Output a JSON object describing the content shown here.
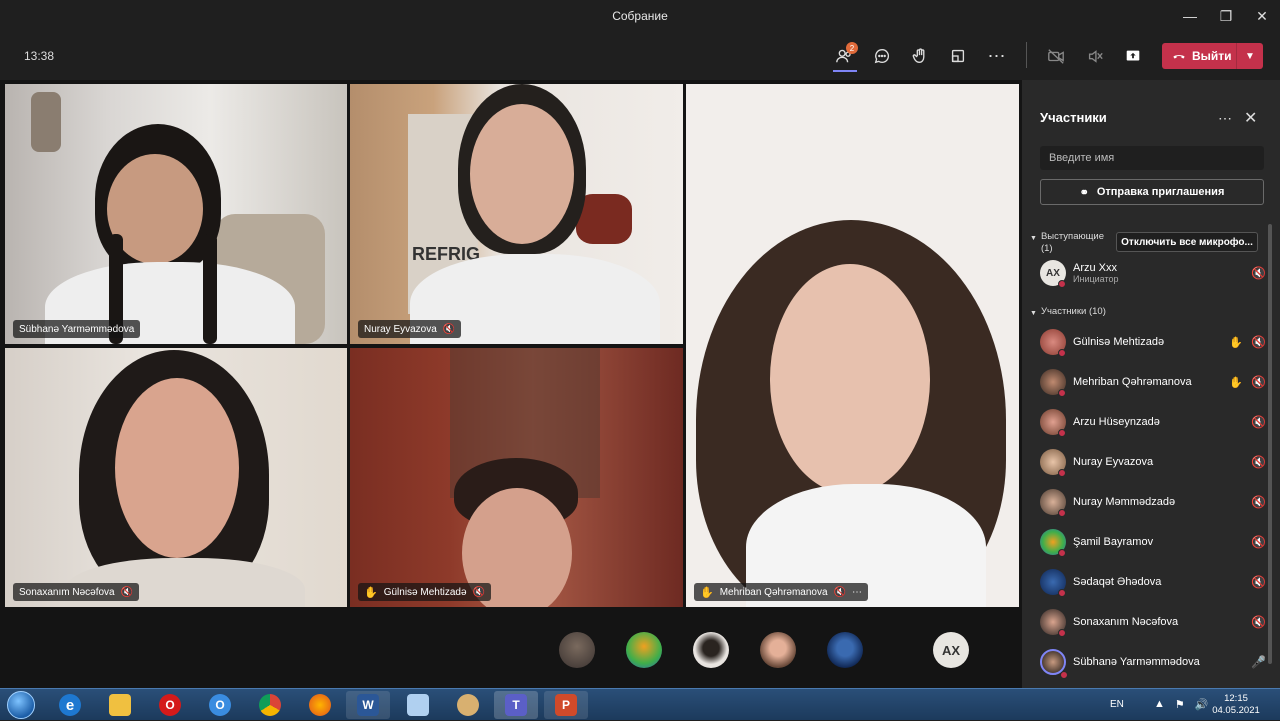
{
  "window": {
    "title": "Собрание"
  },
  "toolbar": {
    "time": "13:38",
    "people_badge": "2",
    "leave_label": "Выйти"
  },
  "tiles": [
    {
      "name": "Sübhanə Yarməmmədova",
      "hand": false,
      "muted": false
    },
    {
      "name": "Nuray Eyvazova",
      "hand": false,
      "muted": true
    },
    {
      "name": "Mehriban Qəhrəmanova",
      "hand": true,
      "muted": true
    },
    {
      "name": "Sonaxanım Nəcəfova",
      "hand": false,
      "muted": true
    },
    {
      "name": "Gülnisə Mehtizadə",
      "hand": true,
      "muted": true
    }
  ],
  "overflow_avatars": {
    "initials": "AX"
  },
  "panel": {
    "title": "Участники",
    "search_placeholder": "Введите имя",
    "invite_label": "Отправка приглашения",
    "presenters_label": "Выступающие",
    "presenters_count": "(1)",
    "mute_all_label": "Отключить все микрофо...",
    "organizer": {
      "initials": "AX",
      "name": "Arzu Xxx",
      "role": "Инициатор"
    },
    "attendees_label": "Участники (10)",
    "attendees": [
      {
        "name": "Gülnisə Mehtizadə",
        "hand": true,
        "mic": "muted"
      },
      {
        "name": "Mehriban Qəhrəmanova",
        "hand": true,
        "mic": "muted"
      },
      {
        "name": "Arzu Hüseynzadə",
        "hand": false,
        "mic": "muted"
      },
      {
        "name": "Nuray Eyvazova",
        "hand": false,
        "mic": "muted"
      },
      {
        "name": "Nuray Məmmədzadə",
        "hand": false,
        "mic": "muted"
      },
      {
        "name": "Şamil Bayramov",
        "hand": false,
        "mic": "muted"
      },
      {
        "name": "Sədaqət Əhədova",
        "hand": false,
        "mic": "muted"
      },
      {
        "name": "Sonaxanım Nəcəfova",
        "hand": false,
        "mic": "muted"
      },
      {
        "name": "Sübhanə Yarməmmədova",
        "hand": false,
        "mic": "on"
      }
    ]
  },
  "taskbar": {
    "lang": "EN",
    "time": "12:15",
    "date": "04.05.2021"
  }
}
